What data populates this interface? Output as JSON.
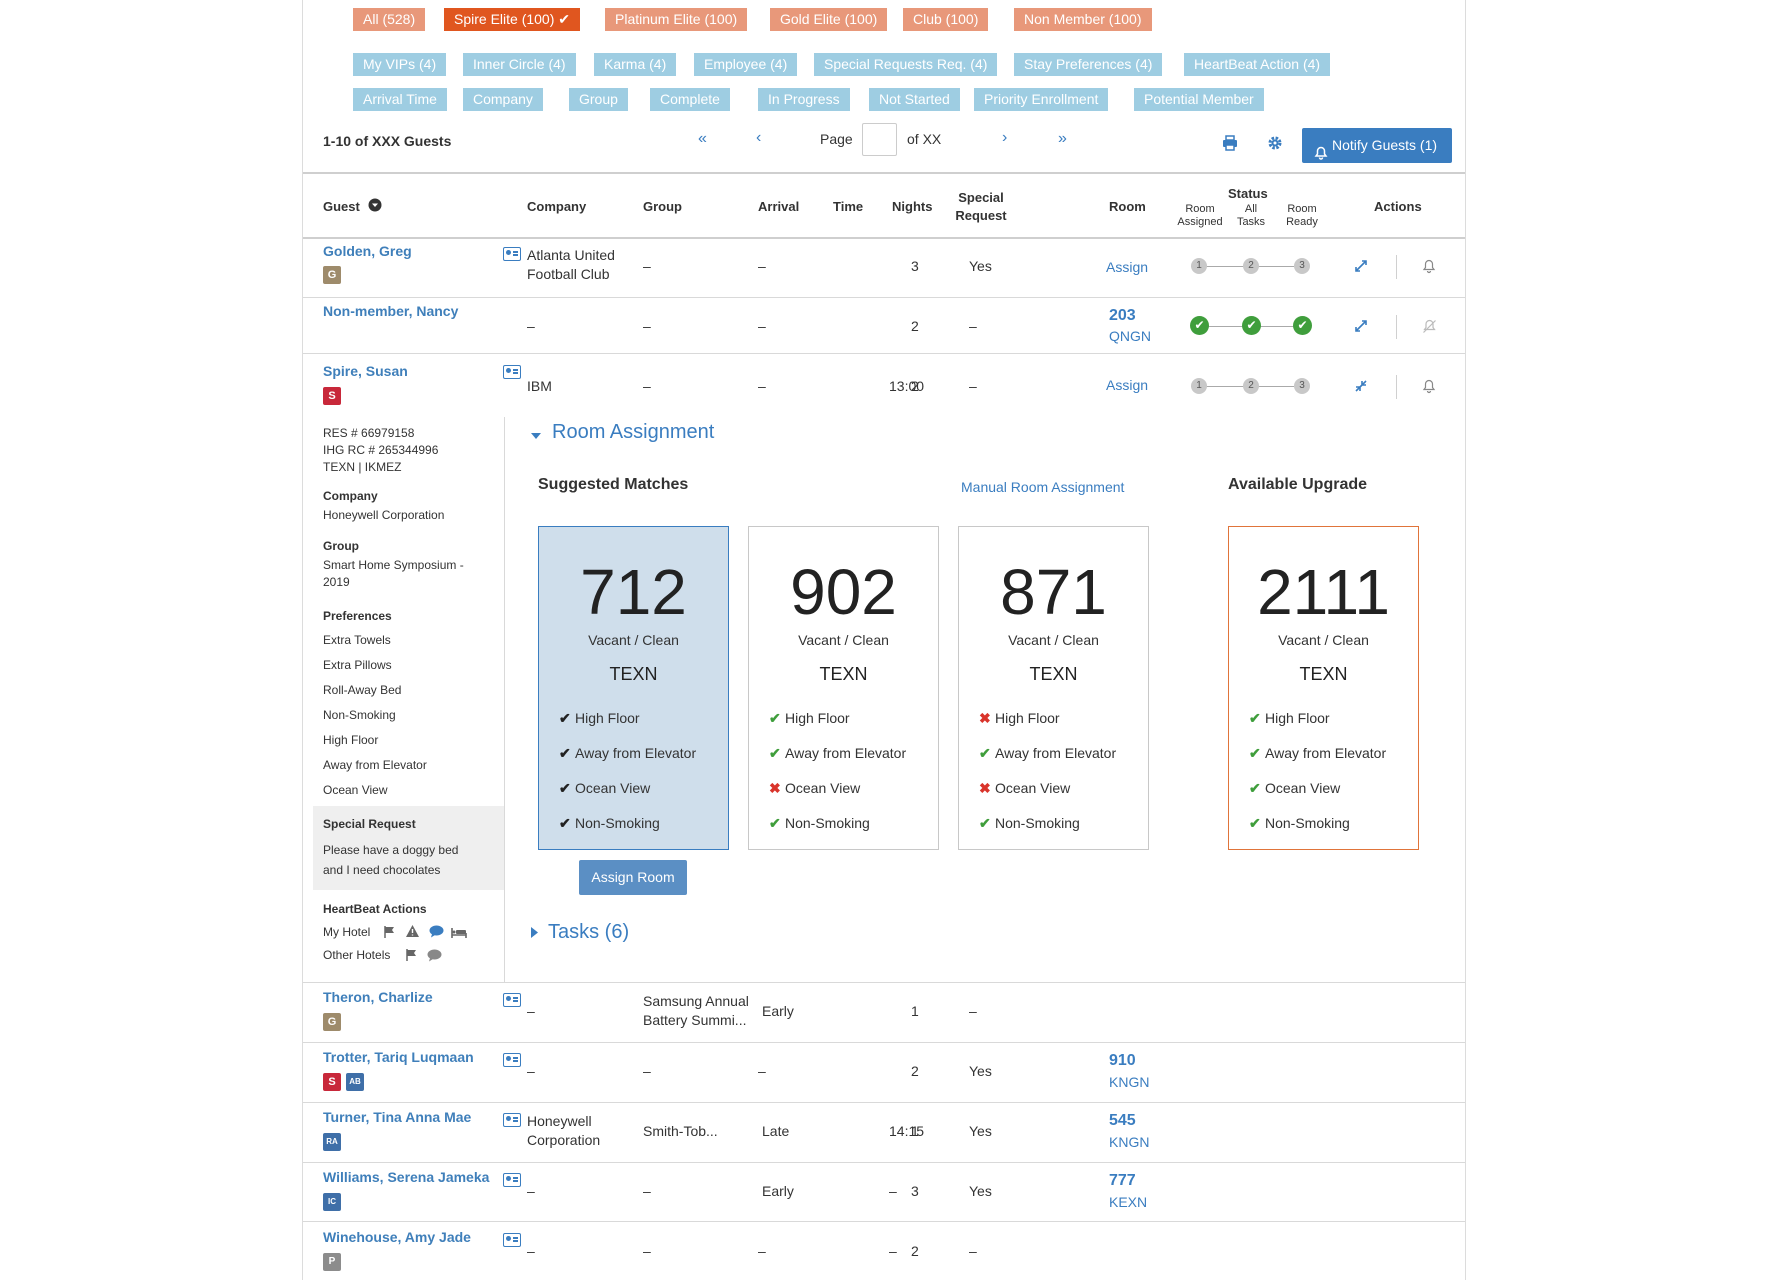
{
  "tier_filters": [
    {
      "label": "All (528)",
      "active": false
    },
    {
      "label": "Spire  Elite (100) ✔",
      "active": true
    },
    {
      "label": "Platinum Elite (100)",
      "active": false
    },
    {
      "label": "Gold Elite (100)",
      "active": false
    },
    {
      "label": "Club (100)",
      "active": false
    },
    {
      "label": "Non Member (100)",
      "active": false
    }
  ],
  "filters_row1": [
    "My VIPs (4)",
    "Inner Circle (4)",
    "Karma (4)",
    "Employee (4)",
    "Special Requests Req. (4)",
    "Stay Preferences (4)",
    "HeartBeat Action (4)"
  ],
  "filters_row2": [
    "Arrival Time",
    "Company",
    "Group",
    "Complete",
    "In Progress",
    "Not Started",
    "Priority Enrollment",
    "Potential Member"
  ],
  "toolbar": {
    "count_label": "1-10 of XXX Guests",
    "first": "«",
    "prev": "‹",
    "page_label": "Page",
    "of_label": "of XX",
    "next": "›",
    "last": "»",
    "notify_label": "Notify Guests (1)"
  },
  "columns": {
    "guest": "Guest",
    "company": "Company",
    "group": "Group",
    "arrival": "Arrival",
    "time": "Time",
    "nights": "Nights",
    "special_request_1": "Special",
    "special_request_2": "Request",
    "room": "Room",
    "status": "Status",
    "status_room_assigned_1": "Room",
    "status_room_assigned_2": "Assigned",
    "status_all_tasks_1": "All",
    "status_all_tasks_2": "Tasks",
    "status_room_ready_1": "Room",
    "status_room_ready_2": "Ready",
    "actions": "Actions"
  },
  "rows": [
    {
      "name": "Golden, Greg",
      "badge": "G",
      "company1": "Atlanta United",
      "company2": "Football Club",
      "group": "–",
      "arrival": "–",
      "time": "",
      "nights": "3",
      "special": "Yes",
      "room": "Assign",
      "steps": [
        "1",
        "2",
        "3"
      ]
    },
    {
      "name": "Non-member, Nancy",
      "company1": "–",
      "group": "–",
      "arrival": "–",
      "time": "",
      "nights": "2",
      "special": "–",
      "room": "203",
      "room_code": "QNGN"
    },
    {
      "name": "Spire, Susan",
      "badge": "S",
      "company1": "IBM",
      "group": "–",
      "arrival": "–",
      "time": "13:00",
      "nights": "2",
      "special": "–",
      "room": "Assign",
      "steps": [
        "1",
        "2",
        "3"
      ]
    },
    {
      "name": "Theron, Charlize",
      "badge": "G",
      "company1": "–",
      "group1": "Samsung Annual",
      "group2": "Battery Summi...",
      "arrival": "Early",
      "nights": "1",
      "special": "–"
    },
    {
      "name": "Trotter, Tariq Luqmaan",
      "badge": "S",
      "company1": "–",
      "group": "–",
      "arrival": "–",
      "nights": "2",
      "special": "Yes",
      "room": "910",
      "room_code": "KNGN"
    },
    {
      "name": "Turner, Tina Anna Mae",
      "company1": "Honeywell",
      "company2": "Corporation",
      "group": "Smith-Tob...",
      "arrival": "Late",
      "time": "14:15",
      "nights": "1",
      "special": "Yes",
      "room": "545",
      "room_code": "KNGN"
    },
    {
      "name": "Williams, Serena Jameka",
      "company1": "–",
      "group": "–",
      "arrival": "Early",
      "time": "–",
      "nights": "3",
      "special": "Yes",
      "room": "777",
      "room_code": "KEXN"
    },
    {
      "name": "Winehouse, Amy Jade",
      "company1": "–",
      "group": "–",
      "arrival": "–",
      "time": "–",
      "nights": "2",
      "special": "–"
    }
  ],
  "detail": {
    "res": "RES # 66979158",
    "ihg": "IHG RC # 265344996",
    "codes": "TEXN | IKMEZ",
    "company_label": "Company",
    "company": "Honeywell Corporation",
    "group_label": "Group",
    "group1": "Smart Home Symposium -",
    "group2": "2019",
    "preferences_label": "Preferences",
    "preferences": [
      "Extra Towels",
      "Extra Pillows",
      "Roll-Away Bed",
      "Non-Smoking",
      "High Floor",
      "Away from Elevator",
      "Ocean View"
    ],
    "special_label": "Special Request",
    "special1": "Please have a doggy bed",
    "special2": "and I need chocolates",
    "heartbeat_label": "HeartBeat Actions",
    "my_hotel": "My Hotel",
    "other_hotels": "Other Hotels"
  },
  "room_assignment": {
    "title": "Room Assignment",
    "suggested_label": "Suggested Matches",
    "manual_link": "Manual Room Assignment",
    "upgrade_label": "Available Upgrade",
    "assign_button": "Assign Room",
    "tasks_label": "Tasks (6)",
    "cards": [
      {
        "number": "712",
        "status": "Vacant / Clean",
        "type": "TEXN",
        "features": [
          "High Floor",
          "Away from Elevator",
          "Ocean View",
          "Non-Smoking"
        ],
        "matches": [
          true,
          true,
          true,
          true
        ]
      },
      {
        "number": "902",
        "status": "Vacant / Clean",
        "type": "TEXN",
        "features": [
          "High Floor",
          "Away from Elevator",
          "Ocean View",
          "Non-Smoking"
        ],
        "matches": [
          true,
          true,
          false,
          true
        ]
      },
      {
        "number": "871",
        "status": "Vacant / Clean",
        "type": "TEXN",
        "features": [
          "High Floor",
          "Away from Elevator",
          "Ocean View",
          "Non-Smoking"
        ],
        "matches": [
          false,
          true,
          false,
          true
        ]
      },
      {
        "number": "2111",
        "status": "Vacant / Clean",
        "type": "TEXN",
        "features": [
          "High Floor",
          "Away from Elevator",
          "Ocean View",
          "Non-Smoking"
        ],
        "matches": [
          true,
          true,
          true,
          true
        ]
      }
    ]
  },
  "icons": {
    "check": "✔",
    "cross": "✖",
    "sort": "sort-down-icon",
    "print": "print-icon",
    "gear": "gear-icon",
    "bell": "bell-icon",
    "expand": "expand-icon",
    "collapse": "collapse-icon"
  },
  "colors": {
    "tier": "#e8987a",
    "tier_active": "#e0561f",
    "filter": "#9ecde2",
    "link": "#3a7dc0",
    "ok": "#3f9e3c",
    "error": "#d9342b"
  }
}
